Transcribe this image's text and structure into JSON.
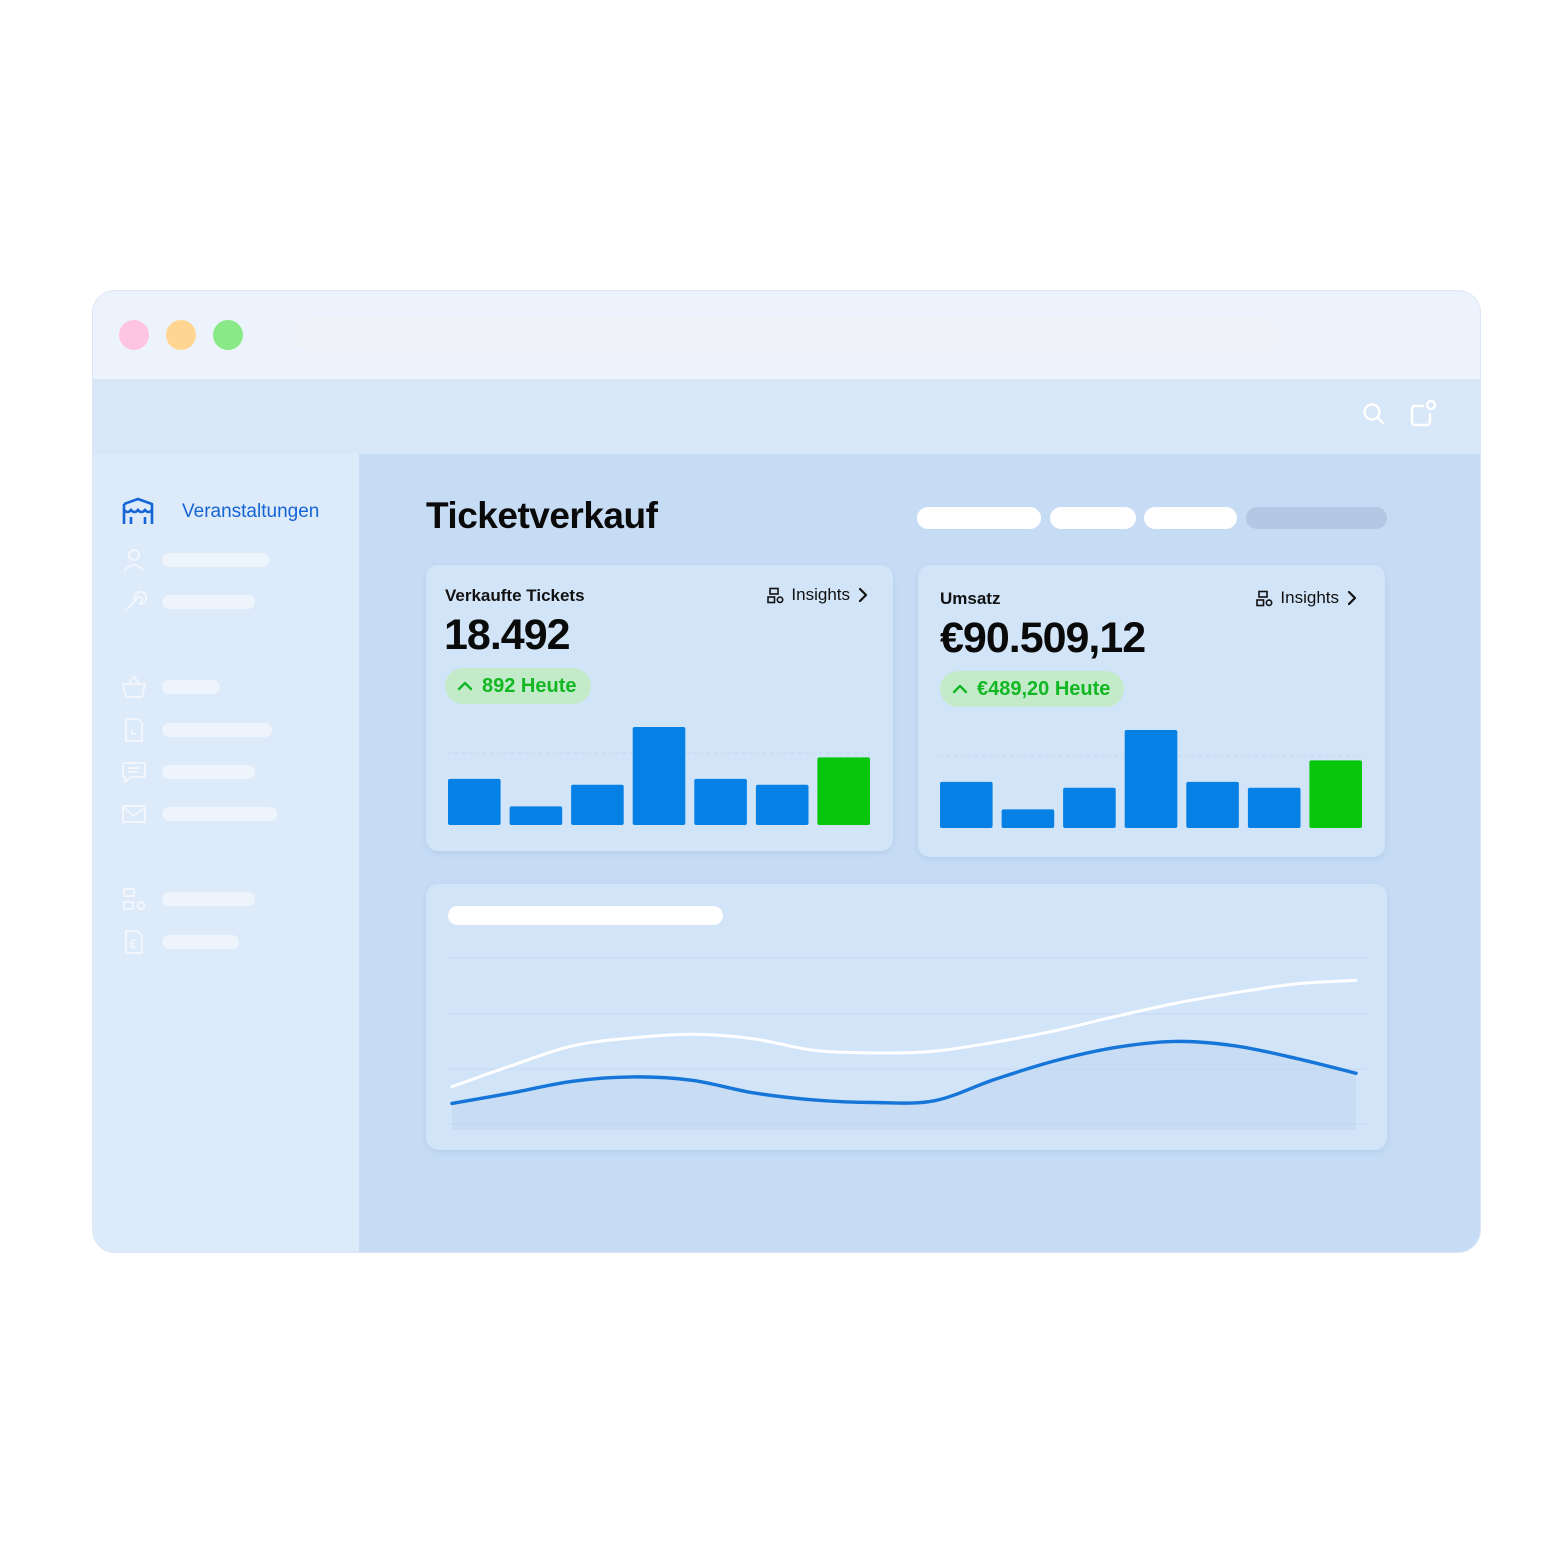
{
  "page": {
    "title": "Ticketverkauf"
  },
  "sidebar": {
    "active_label": "Veranstaltungen"
  },
  "cards": {
    "tickets": {
      "title": "Verkaufte Tickets",
      "insights_label": "Insights",
      "value": "18.492",
      "delta": "892 Heute"
    },
    "revenue": {
      "title": "Umsatz",
      "insights_label": "Insights",
      "value": "€90.509,12",
      "delta": "€489,20 Heute"
    }
  },
  "colors": {
    "bar": "#0581e6",
    "bar_today": "#07c70d",
    "line_primary": "#1575d8",
    "line_secondary": "#ffffff",
    "accent": "#1565d6",
    "positive": "#12b824"
  },
  "chart_data": [
    {
      "type": "bar",
      "series": [
        {
          "values": [
            0.47,
            0.19,
            0.41,
            1.0,
            0.47,
            0.41,
            0.69
          ]
        }
      ],
      "highlight_last": true,
      "ylim": [
        0,
        1
      ]
    },
    {
      "type": "bar",
      "series": [
        {
          "values": [
            0.47,
            0.19,
            0.41,
            1.0,
            0.47,
            0.41,
            0.69
          ]
        }
      ],
      "highlight_last": true,
      "ylim": [
        0,
        1
      ]
    },
    {
      "type": "line",
      "series": [
        {
          "values": [
            0.3,
            0.42,
            0.55,
            0.6,
            0.56,
            0.42,
            0.34,
            0.31,
            0.33,
            0.57,
            0.78,
            0.93,
            1.0,
            0.95,
            0.81,
            0.64
          ]
        },
        {
          "values": [
            0.49,
            0.73,
            0.95,
            1.04,
            1.08,
            1.03,
            0.9,
            0.87,
            0.89,
            0.99,
            1.12,
            1.28,
            1.43,
            1.55,
            1.65,
            1.69
          ]
        }
      ],
      "ylim": [
        0,
        2.1
      ]
    }
  ]
}
